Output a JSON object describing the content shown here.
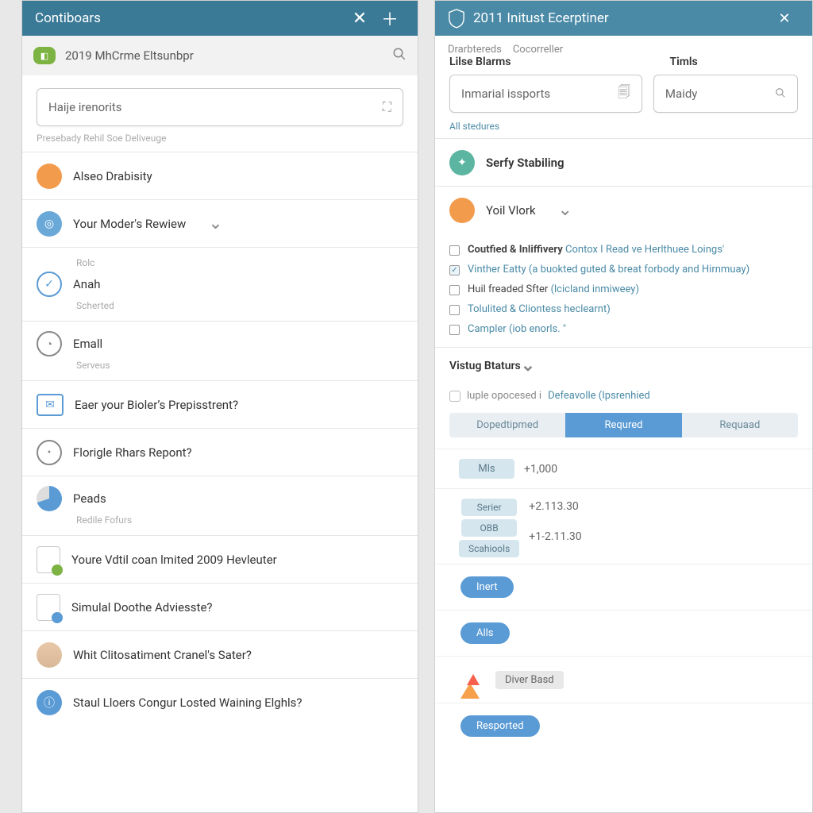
{
  "left": {
    "title": "Contiboars",
    "subbar": "2019 MhCrme Eltsunbpr",
    "search_placeholder": "Haije irenorits",
    "hint": "Presebady Rehil Soe Deliveuge",
    "rows": [
      {
        "name": "Alseo Drabisity"
      },
      {
        "name": "Your Moder's Rewiew"
      },
      {
        "name": "Anah",
        "role": "Rolc",
        "sub": "Scherted"
      },
      {
        "name": "Emall",
        "sub": "Serveus"
      },
      {
        "name": "Eaer your Bioler’s Prepisstrent?"
      },
      {
        "name": "Florigle Rhars Repont?"
      },
      {
        "name": "Peads",
        "sub": "Redile Fofurs"
      },
      {
        "name": "Youre Vdtil coan lmited 2009 Hevleuter"
      },
      {
        "name": "Simulal Doothe Adviesste?"
      },
      {
        "name": "Whit Clitosatiment Cranel's Sater?"
      },
      {
        "name": "Staul Lloers Congur Losted Waining Elghls?"
      }
    ]
  },
  "right": {
    "title": "2011 Initust Ecerptiner",
    "tabs": [
      "Drarbtereds",
      "Cocorreller"
    ],
    "col1_label": "Lilse Blarms",
    "col2_label": "Timls",
    "input1_placeholder": "Inmarial issports",
    "input2_placeholder": "Maidy",
    "all_link": "All stedures",
    "people": [
      "Serfy Stabiling",
      "Yoil Vlork"
    ],
    "checks": [
      {
        "on": false,
        "a": "Coutfied & Inliffivery",
        "b": "Contox I Read ve Herlthuee Loings'"
      },
      {
        "on": true,
        "a": "Vinther Eatty",
        "b": "(a buokted guted & breat forbody and Hirnmuay)"
      },
      {
        "on": false,
        "a": "Huil freaded Sfter",
        "b": "(lcicland inmiweey)"
      },
      {
        "on": false,
        "a": "Tolulited & Cliontess",
        "b": "heclearnt)"
      },
      {
        "on": false,
        "a": "Campler",
        "b": "(iob enorls.   \""
      }
    ],
    "section2": "Vistug Btaturs",
    "status_pre": "luple opocesed i",
    "status_link": "Defeavolle (Ipsrenhied",
    "seg": [
      "Dopedtipmed",
      "Requred",
      "Requaad"
    ],
    "data": [
      {
        "chips": [
          "Mls"
        ],
        "val": "+1,000"
      },
      {
        "chips": [
          "Serier",
          "OBB",
          "Scahiools"
        ],
        "val": "+2.113.30",
        "val2": "+1-2.11.30"
      }
    ],
    "actions": {
      "inert": "Inert",
      "alls": "Alls",
      "diver": "Diver Basd",
      "resported": "Resported"
    }
  }
}
